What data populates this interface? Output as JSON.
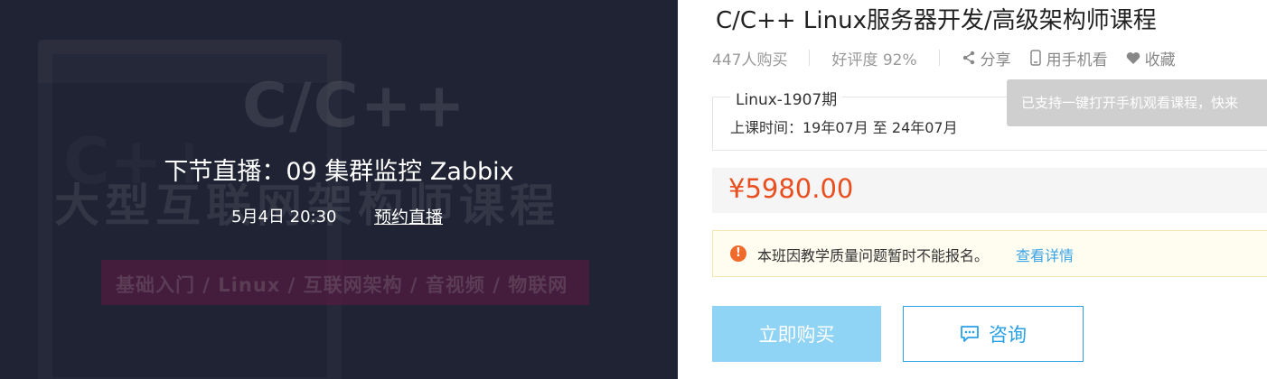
{
  "banner": {
    "bg_title": "C/C++",
    "bg_logo": "C++",
    "bg_subtitle": "大型互联网架构师课程",
    "bg_tags": "基础入门 / Linux / 互联网架构 / 音视频 / 物联网",
    "next_live": "下节直播：09 集群监控 Zabbix",
    "live_time": "5月4日 20:30",
    "reserve_label": "预约直播"
  },
  "course": {
    "title": "C/C++ Linux服务器开发/高级架构师课程",
    "buyers": "447人购买",
    "rating": "好评度 92%",
    "share_label": "分享",
    "mobile_label": "用手机看",
    "favorite_label": "收藏",
    "tooltip": "已支持一键打开手机观看课程，快来"
  },
  "period": {
    "label": "Linux-1907期",
    "time": "上课时间：19年07月 至 24年07月"
  },
  "price": "¥5980.00",
  "notice": {
    "icon": "!",
    "text": "本班因教学质量问题暂时不能报名。",
    "link": "查看详情"
  },
  "actions": {
    "buy_label": "立即购买",
    "consult_label": "咨询"
  },
  "colors": {
    "price": "#e94e1f",
    "accent": "#29a1e6",
    "buy_button": "#8fd3f5",
    "banner_bg": "#262a3d"
  }
}
